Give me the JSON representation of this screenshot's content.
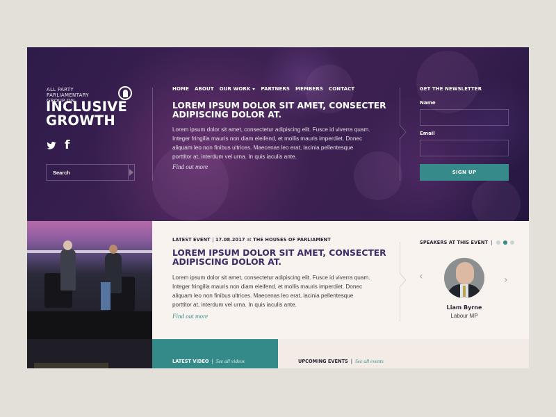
{
  "brand": {
    "tagline_lines": [
      "ALL PARTY",
      "PARLIAMENTARY",
      "GROUP ON"
    ],
    "name_lines": [
      "INCLUSIVE",
      "GROWTH"
    ]
  },
  "social": {
    "twitter_icon": "twitter-icon",
    "facebook_icon": "facebook-icon",
    "facebook_glyph": "f"
  },
  "search": {
    "placeholder": "Search",
    "button_icon": "arrow-right-icon"
  },
  "nav": {
    "items": [
      {
        "label": "HOME"
      },
      {
        "label": "ABOUT"
      },
      {
        "label": "OUR WORK",
        "has_dropdown": true
      },
      {
        "label": "PARTNERS"
      },
      {
        "label": "MEMBERS"
      },
      {
        "label": "CONTACT"
      }
    ]
  },
  "hero": {
    "title": "LOREM IPSUM DOLOR SIT AMET, CONSECTER ADIPISCING DOLOR AT.",
    "body": "Lorem ipsum dolor sit amet, consectetur adipiscing elit. Fusce id viverra quam. Integer fringilla mauris non diam eleifend, et mollis mauris imperdiet. Donec aliquam leo non finibus ultrices. Maecenas leo erat, lacinia pellentesque porttitor at, interdum vel urna. In quis iaculis ante.",
    "link": "Find out more"
  },
  "newsletter": {
    "title": "GET THE NEWSLETTER",
    "name_label": "Name",
    "name_value": "",
    "email_label": "Email",
    "email_value": "",
    "button": "SIGN UP",
    "button_color": "#368b8a"
  },
  "event": {
    "label": "LATEST EVENT",
    "separator": "|",
    "date": "17.08.2017",
    "at": "at",
    "venue": "THE HOUSES OF PARLIAMENT",
    "title": "LOREM IPSUM DOLOR SIT AMET, CONSECTER ADIPISCING DOLOR AT.",
    "body": "Lorem ipsum dolor sit amet, consectetur adipiscing elit. Fusce id viverra quam. Integer fringilla mauris non diam eleifend, et mollis mauris imperdiet. Donec aliquam leo non finibus ultrices. Maecenas leo erat, lacinia pellentesque porttitor at, interdum vel urna. In quis iaculis ante.",
    "link": "Find out more",
    "title_color": "#3f2a68",
    "link_color": "#3a8f8b"
  },
  "speakers": {
    "title": "SPEAKERS AT THIS EVENT",
    "separator": "|",
    "dots_total": 3,
    "dots_active_index": 1,
    "prev_glyph": "‹",
    "next_glyph": "›",
    "current": {
      "name": "Liam Byrne",
      "role": "Labour MP"
    }
  },
  "bottom": {
    "video": {
      "label": "LATEST VIDEO",
      "separator": "|",
      "link": "See all videos"
    },
    "upcoming": {
      "label": "UPCOMING EVENTS",
      "separator": "|",
      "link": "See all events"
    }
  }
}
